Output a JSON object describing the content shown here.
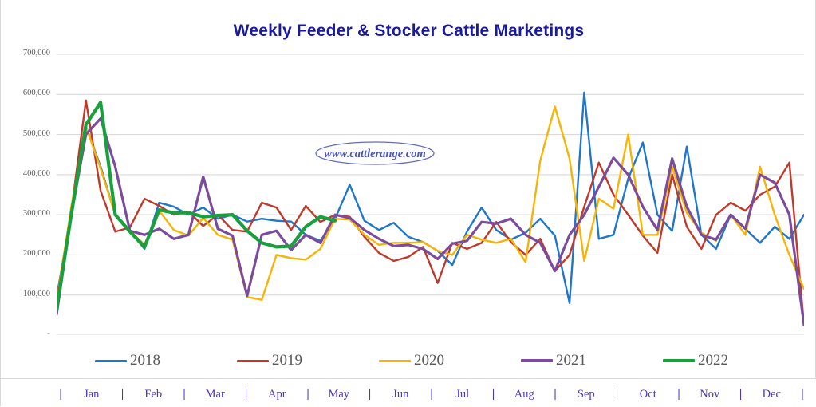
{
  "chart": {
    "title": "Weekly Feeder & Stocker Cattle Marketings",
    "watermark": "www.cattlerange.com"
  },
  "y_axis": {
    "ticks": [
      "700,000",
      "600,000",
      "500,000",
      "400,000",
      "300,000",
      "200,000",
      "100,000",
      "-"
    ]
  },
  "x_axis": {
    "separator": "|",
    "months": [
      "Jan",
      "Feb",
      "Mar",
      "Apr",
      "May",
      "Jun",
      "Jul",
      "Aug",
      "Sep",
      "Oct",
      "Nov",
      "Dec"
    ]
  },
  "legend": {
    "items": [
      {
        "label": "2018",
        "color": "#2077C9"
      },
      {
        "label": "2019",
        "color": "#BE3A2B"
      },
      {
        "label": "2020",
        "color": "#F5B407"
      },
      {
        "label": "2021",
        "color": "#7B4B9C"
      },
      {
        "label": "2022",
        "color": "#17A03C"
      }
    ]
  },
  "chart_data": {
    "type": "line",
    "title": "Weekly Feeder & Stocker Cattle Marketings",
    "xlabel": "",
    "ylabel": "",
    "ylim": [
      0,
      700000
    ],
    "ytick_values": [
      0,
      100000,
      200000,
      300000,
      400000,
      500000,
      600000,
      700000
    ],
    "grid": "horizontal",
    "legend_position": "bottom",
    "x_unit": "week",
    "x_count": 52,
    "x_categories": [
      "Jan",
      "Feb",
      "Mar",
      "Apr",
      "May",
      "Jun",
      "Jul",
      "Aug",
      "Sep",
      "Oct",
      "Nov",
      "Dec"
    ],
    "series": [
      {
        "name": "2018",
        "color": "#2077C9",
        "width": 2.4,
        "values": [
          95000,
          300000,
          520000,
          420000,
          300000,
          258000,
          215000,
          330000,
          320000,
          300000,
          318000,
          290000,
          300000,
          283000,
          290000,
          285000,
          283000,
          250000,
          235000,
          290000,
          375000,
          285000,
          262000,
          280000,
          245000,
          232000,
          210000,
          175000,
          258000,
          318000,
          262000,
          238000,
          255000,
          290000,
          248000,
          80000,
          605000,
          240000,
          250000,
          390000,
          480000,
          300000,
          260000,
          470000,
          250000,
          215000,
          300000,
          265000,
          230000,
          270000,
          240000,
          300000
        ]
      },
      {
        "name": "2019",
        "color": "#BE3A2B",
        "width": 2.4,
        "values": [
          90000,
          310000,
          585000,
          360000,
          258000,
          268000,
          340000,
          322000,
          300000,
          308000,
          272000,
          300000,
          262000,
          258000,
          330000,
          318000,
          262000,
          322000,
          282000,
          300000,
          295000,
          245000,
          205000,
          185000,
          195000,
          220000,
          130000,
          230000,
          215000,
          230000,
          282000,
          232000,
          200000,
          240000,
          160000,
          200000,
          320000,
          430000,
          350000,
          300000,
          248000,
          205000,
          400000,
          270000,
          215000,
          300000,
          330000,
          310000,
          350000,
          370000,
          430000,
          25000
        ]
      },
      {
        "name": "2020",
        "color": "#F5B407",
        "width": 2.4,
        "values": [
          80000,
          320000,
          520000,
          415000,
          300000,
          260000,
          225000,
          310000,
          262000,
          248000,
          292000,
          250000,
          238000,
          95000,
          88000,
          200000,
          192000,
          188000,
          215000,
          290000,
          288000,
          250000,
          225000,
          230000,
          230000,
          232000,
          210000,
          200000,
          250000,
          238000,
          230000,
          240000,
          182000,
          435000,
          570000,
          440000,
          185000,
          340000,
          315000,
          500000,
          250000,
          250000,
          420000,
          305000,
          255000,
          235000,
          300000,
          250000,
          420000,
          300000,
          200000,
          115000
        ]
      },
      {
        "name": "2021",
        "color": "#7B4B9C",
        "width": 3.2,
        "values": [
          52000,
          300000,
          500000,
          540000,
          420000,
          260000,
          250000,
          265000,
          240000,
          250000,
          395000,
          265000,
          248000,
          98000,
          250000,
          260000,
          212000,
          250000,
          230000,
          300000,
          292000,
          262000,
          240000,
          222000,
          225000,
          215000,
          190000,
          228000,
          235000,
          282000,
          278000,
          290000,
          250000,
          230000,
          160000,
          250000,
          300000,
          370000,
          442000,
          400000,
          320000,
          262000,
          440000,
          320000,
          250000,
          238000,
          300000,
          265000,
          400000,
          380000,
          300000,
          25000
        ]
      },
      {
        "name": "2022",
        "color": "#17A03C",
        "width": 4.2,
        "values": [
          65000,
          300000,
          525000,
          580000,
          300000,
          258000,
          220000,
          312000,
          305000,
          305000,
          295000,
          298000,
          300000,
          260000,
          230000,
          220000,
          222000,
          270000,
          295000,
          285000
        ]
      }
    ]
  }
}
